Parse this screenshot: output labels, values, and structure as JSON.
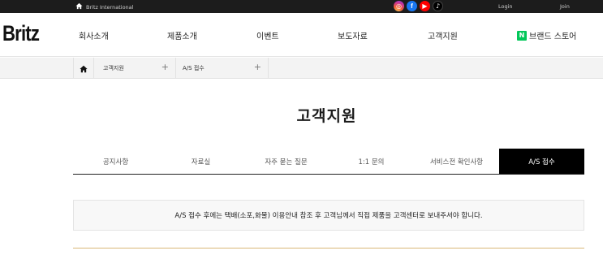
{
  "topbar": {
    "international": "Britz International",
    "social_icons": [
      "instagram-icon",
      "facebook-icon",
      "youtube-icon",
      "tiktok-icon"
    ],
    "social_glyphs": {
      "instagram": "◎",
      "facebook": "f",
      "youtube": "▶",
      "tiktok": "♪"
    },
    "login": "Login",
    "join": "Join"
  },
  "header": {
    "logo": "Britz",
    "nav": [
      "회사소개",
      "제품소개",
      "이벤트",
      "보도자료",
      "고객지원",
      "브랜드 스토어"
    ],
    "naver_badge": "N",
    "naver_color": "#03c75a"
  },
  "breadcrumb": {
    "items": [
      {
        "label": "고객지원",
        "plus": "+"
      },
      {
        "label": "A/S 접수",
        "plus": "+"
      }
    ]
  },
  "page": {
    "title": "고객지원"
  },
  "tabs": [
    {
      "label": "공지사항",
      "active": false
    },
    {
      "label": "자료실",
      "active": false
    },
    {
      "label": "자주 묻는 질문",
      "active": false
    },
    {
      "label": "1:1 문의",
      "active": false
    },
    {
      "label": "서비스전 확인사항",
      "active": false
    },
    {
      "label": "A/S 접수",
      "active": true
    }
  ],
  "notice": {
    "text": "A/S 접수 후에는 택배(소포,화물) 이용안내 참조 후 고객님께서 직접 제품을 고객센터로 보내주셔야 합니다."
  },
  "colors": {
    "topbar_bg": "#1c1c1c",
    "active_tab_bg": "#000000",
    "divider_gold": "#d9b878"
  }
}
